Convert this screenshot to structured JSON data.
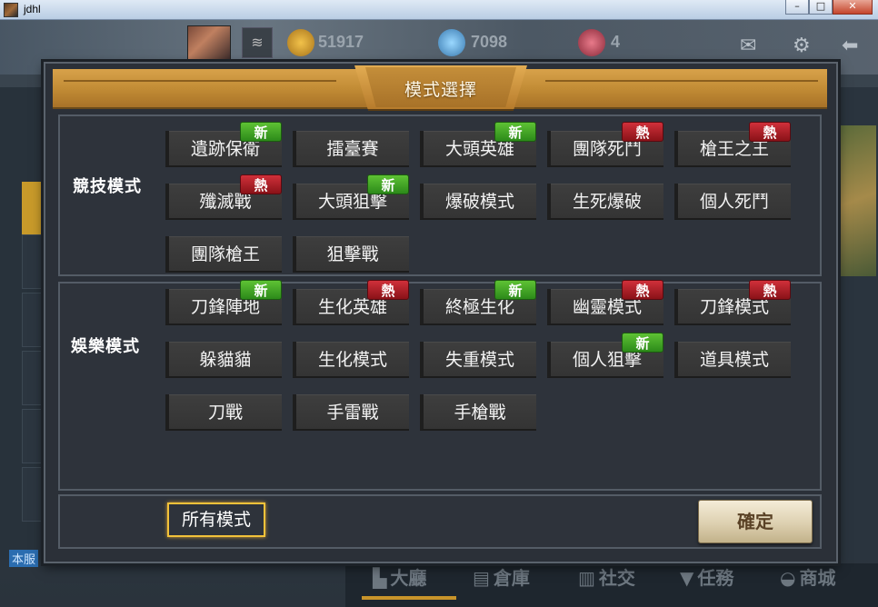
{
  "window": {
    "title": "jdhl",
    "controls": [
      "–",
      "□",
      "✕"
    ]
  },
  "topbar": {
    "gold": "51917",
    "diamond": "7098",
    "tickets": "4"
  },
  "server_tag": "本服",
  "bottom_nav": [
    "大廳",
    "倉庫",
    "社交",
    "任務",
    "商城"
  ],
  "dialog": {
    "title": "模式選擇",
    "sections": [
      {
        "label": "競技模式",
        "modes": [
          {
            "label": "遺跡保衛",
            "badge": "新"
          },
          {
            "label": "擂臺賽",
            "badge": ""
          },
          {
            "label": "大頭英雄",
            "badge": "新"
          },
          {
            "label": "團隊死鬥",
            "badge": "熱"
          },
          {
            "label": "槍王之王",
            "badge": "熱"
          },
          {
            "label": "殲滅戰",
            "badge": "熱"
          },
          {
            "label": "大頭狙擊",
            "badge": "新"
          },
          {
            "label": "爆破模式",
            "badge": ""
          },
          {
            "label": "生死爆破",
            "badge": ""
          },
          {
            "label": "個人死鬥",
            "badge": ""
          },
          {
            "label": "團隊槍王",
            "badge": ""
          },
          {
            "label": "狙擊戰",
            "badge": ""
          }
        ]
      },
      {
        "label": "娛樂模式",
        "modes": [
          {
            "label": "刀鋒陣地",
            "badge": "新"
          },
          {
            "label": "生化英雄",
            "badge": "熱"
          },
          {
            "label": "終極生化",
            "badge": "新"
          },
          {
            "label": "幽靈模式",
            "badge": "熱"
          },
          {
            "label": "刀鋒模式",
            "badge": "熱"
          },
          {
            "label": "躲貓貓",
            "badge": ""
          },
          {
            "label": "生化模式",
            "badge": ""
          },
          {
            "label": "失重模式",
            "badge": ""
          },
          {
            "label": "個人狙擊",
            "badge": "新"
          },
          {
            "label": "道具模式",
            "badge": ""
          },
          {
            "label": "刀戰",
            "badge": ""
          },
          {
            "label": "手雷戰",
            "badge": ""
          },
          {
            "label": "手槍戰",
            "badge": ""
          }
        ]
      }
    ],
    "all_modes_label": "所有模式",
    "confirm_label": "確定"
  },
  "colors": {
    "header_gold": "#c08a34",
    "badge_new": "#3aa020",
    "badge_hot": "#b01c24",
    "highlight": "#f2c23a"
  },
  "icons": [
    "mail-icon",
    "gear-icon",
    "back-arrow-icon",
    "gold-coin-icon",
    "diamond-icon",
    "ticket-icon",
    "rank-icon"
  ]
}
